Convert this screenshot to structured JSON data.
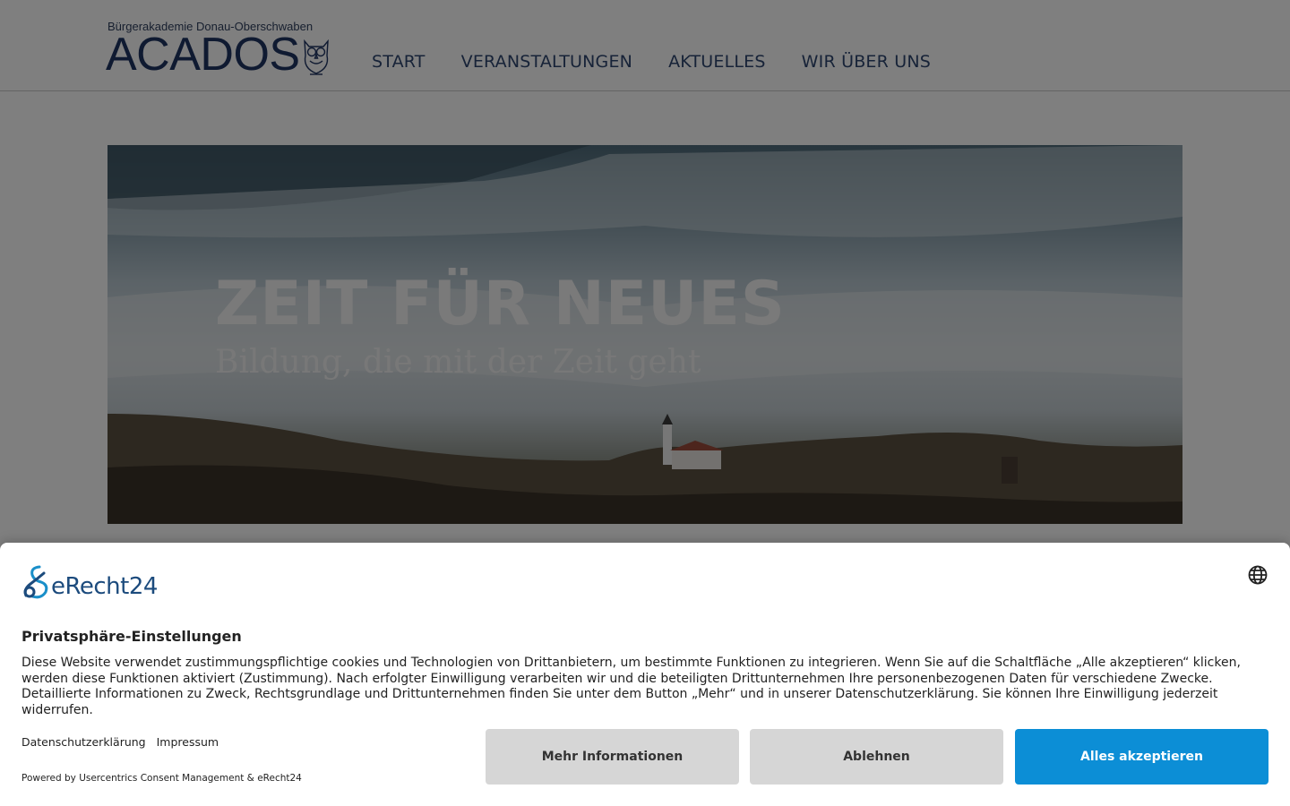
{
  "header": {
    "logo_tagline": "Bürgerakademie Donau-Oberschwaben",
    "logo_word": "ACADOS",
    "nav": [
      {
        "label": "START"
      },
      {
        "label": "VERANSTALTUNGEN"
      },
      {
        "label": "AKTUELLES"
      },
      {
        "label": "WIR ÜBER UNS"
      }
    ]
  },
  "hero": {
    "title": "ZEIT FÜR NEUES",
    "subtitle": "Bildung, die mit der Zeit geht"
  },
  "consent": {
    "brand": "eRecht24",
    "title": "Privatsphäre-Einstellungen",
    "text": "Diese Website verwendet zustimmungspflichtige cookies und Technologien von Drittanbietern, um bestimmte Funktionen zu integrieren. Wenn Sie auf die Schaltfläche „Alle akzeptieren“ klicken, werden diese Funktionen aktiviert (Zustimmung). Nach erfolgter Einwilligung verarbeiten wir und die beteiligten Drittunternehmen Ihre personenbezogenen Daten für verschiedene Zwecke. Detaillierte Informationen zu Zweck, Rechtsgrundlage und Drittunternehmen finden Sie unter dem Button „Mehr“ und in unserer Datenschutzerklärung. Sie können Ihre Einwilligung jederzeit widerrufen.",
    "links": {
      "privacy": "Datenschutzerklärung",
      "imprint": "Impressum"
    },
    "powered_by": "Powered by Usercentrics Consent Management & eRecht24",
    "buttons": {
      "more": "Mehr Informationen",
      "decline": "Ablehnen",
      "accept": "Alles akzeptieren"
    },
    "colors": {
      "accept": "#0c8ed6",
      "secondary": "#d6d6d6"
    }
  },
  "icons": {
    "language": "globe-icon",
    "logo_mascot": "owl-icon"
  }
}
